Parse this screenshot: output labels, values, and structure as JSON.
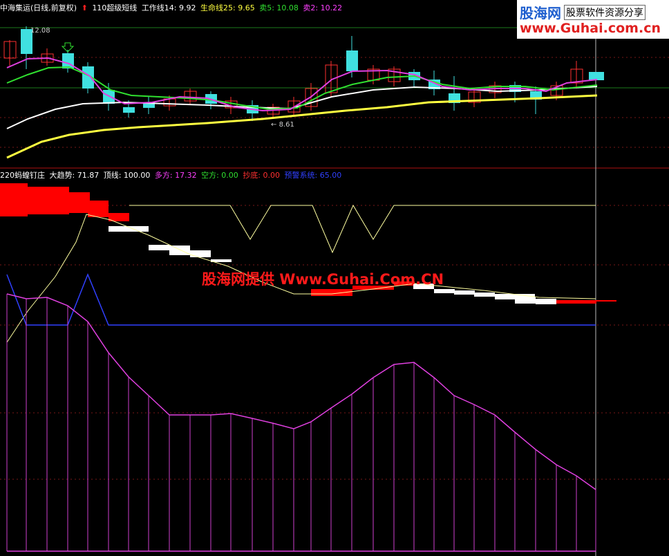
{
  "top_panel": {
    "stock_name": "中海集运(日线,前复权)",
    "indicator_name": "110超级短线",
    "work_line": "工作线14: 9.92",
    "life_line": "生命线25: 9.65",
    "sell5": "卖5: 10.08",
    "sell2": "卖2: 10.22",
    "high_label": "12.08",
    "low_label": "8.61",
    "colors": {
      "work": "#ffffff",
      "life": "#ffff00",
      "sell5": "#00ff00",
      "sell2": "#ff40ff"
    }
  },
  "bottom_panel": {
    "indicator_name": "220蚂蝗钉庄",
    "trend": "大趋势: 71.87",
    "top_line": "顶线: 100.00",
    "long": "多方: 17.32",
    "short": "空方: 0.00",
    "bottom_fish": "抄底: 0.00",
    "alarm": "预警系统: 65.00",
    "colors": {
      "long": "#ff40ff",
      "short": "#00ff00",
      "bottom_fish": "#ff3030",
      "alarm": "#3040ff"
    }
  },
  "logo": {
    "name": "股海网",
    "slogan": "股票软件资源分享",
    "url": "www.Guhai.com.cn"
  },
  "watermark": "股海网提供 Www.Guhai.Com.CN"
}
